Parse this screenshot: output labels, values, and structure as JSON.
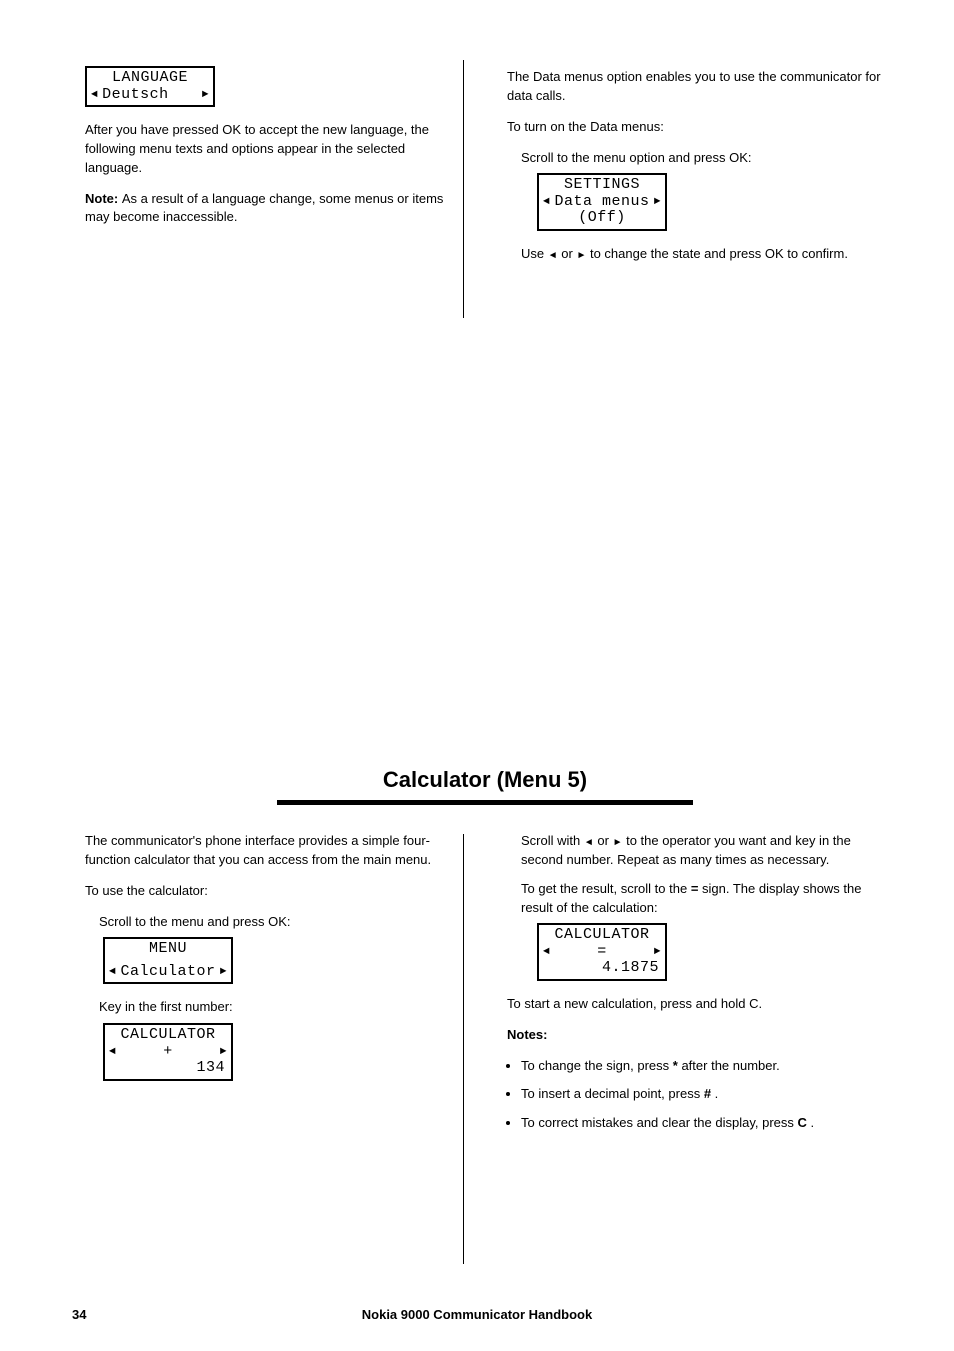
{
  "page": {
    "number": "34",
    "book_title": "Nokia 9000 Communicator Handbook"
  },
  "top_left": {
    "lcd": {
      "title": "LANGUAGE",
      "value": "Deutsch"
    },
    "p1": "After you have pressed OK to accept the new language, the following menu texts and options appear in the selected language.",
    "p2_lead": "Note: ",
    "p2": "As a result of a language change, some menus or items may become inaccessible."
  },
  "top_right": {
    "p1": "The Data menus option enables you to use the communicator for data calls.",
    "p2": "To turn on the Data menus:",
    "li1": "Scroll to the menu option and press OK:",
    "lcd": {
      "title": "SETTINGS",
      "value": "Data menus",
      "state": "(Off)"
    },
    "li2a": "Use ",
    "li2b": " or ",
    "li2c": " to change the state and press OK to confirm."
  },
  "calc": {
    "heading": "Calculator (Menu 5)",
    "intro": "The communicator's phone interface provides a simple four-function calculator that you can access from the main menu.",
    "proc_lead": "To use the calculator:",
    "li1": "Scroll to the menu and press OK:",
    "lcd_menu": {
      "title": "MENU",
      "value": "Calculator"
    },
    "li2": "Key in the first number:",
    "lcd_entry": {
      "title": "CALCULATOR",
      "op": "+",
      "value": "134"
    },
    "right_p1a": "Scroll with ",
    "right_p1b": " or ",
    "right_p1c": " to the operator you want and key in the second number. Repeat as many times as necessary.",
    "right_p2a": "To get the result, scroll to the ",
    "right_p2b": " sign. The display shows the result of the calculation:",
    "equals": "=",
    "lcd_result": {
      "title": "CALCULATOR",
      "op": "=",
      "value": "4.1875"
    },
    "after": "To start a new calculation, press and hold C.",
    "notes_lead": "Notes:",
    "n1a": "To change the sign, press ",
    "n1b": " after the number.",
    "n1c": "*",
    "n2a": "To insert a decimal point, press ",
    "n2b": ".",
    "n2c": "#",
    "n3a": "To correct mistakes and clear the display, press ",
    "n3b": ".",
    "n3c": "C",
    "arrow_left": "◄",
    "arrow_right": "►"
  },
  "glyphs": {
    "left": "◄",
    "right": "►"
  }
}
